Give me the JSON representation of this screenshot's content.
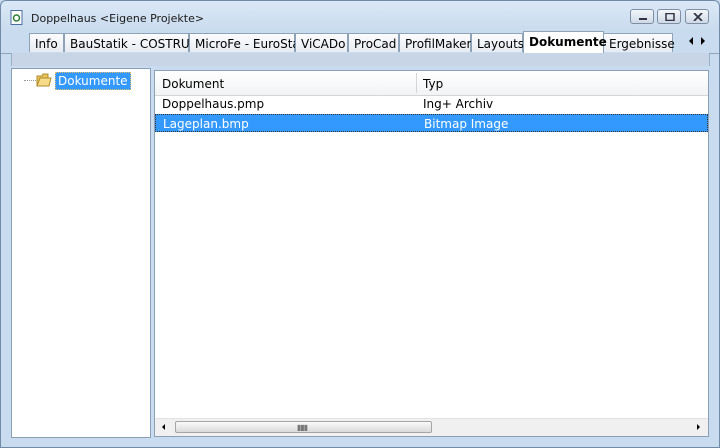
{
  "window": {
    "title": "Doppelhaus <Eigene Projekte>"
  },
  "tabs": [
    {
      "label": "Info"
    },
    {
      "label": "BauStatik - COSTRUC"
    },
    {
      "label": "MicroFe - EuroSta"
    },
    {
      "label": "ViCADo"
    },
    {
      "label": "ProCad"
    },
    {
      "label": "ProfilMaker"
    },
    {
      "label": "Layouts"
    },
    {
      "label": "Dokumente",
      "active": true
    },
    {
      "label": "Ergebnisse"
    }
  ],
  "tree": {
    "root_label": "Dokumente"
  },
  "list": {
    "columns": [
      "Dokument",
      "Typ"
    ],
    "rows": [
      {
        "dokument": "Doppelhaus.pmp",
        "typ": "Ing+ Archiv",
        "selected": false
      },
      {
        "dokument": "Lageplan.bmp",
        "typ": "Bitmap Image",
        "selected": true
      }
    ]
  },
  "colors": {
    "selection": "#3399ff",
    "frame": "#c9dbee"
  }
}
